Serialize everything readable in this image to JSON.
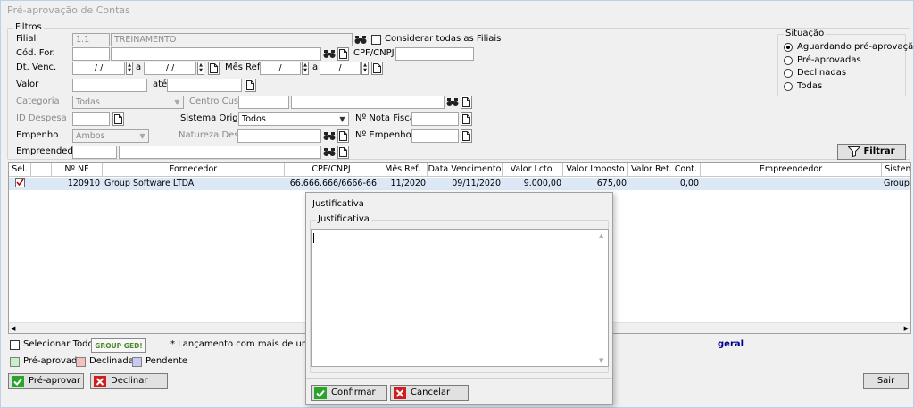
{
  "window": {
    "title": "Pré-aprovação de Contas"
  },
  "filters": {
    "group_label": "Filtros",
    "filial_label": "Filial",
    "filial_code": "1.1",
    "filial_name": "TREINAMENTO",
    "all_filiais_label": "Considerar todas as Filiais",
    "cod_for_label": "Cód. For.",
    "cpf_cnpj_label": "CPF/CNPJ",
    "dt_venc_label": "Dt. Venc.",
    "date_empty": " / /",
    "a_label": "a",
    "mes_ref_label": "Mês Ref.",
    "mes_empty": "/",
    "valor_label": "Valor",
    "ate_label": "até",
    "categoria_label": "Categoria",
    "categoria_value": "Todas",
    "centro_custo_label": "Centro Custo",
    "id_despesa_label": "ID Despesa",
    "sistema_origem_label": "Sistema Origem",
    "sistema_origem_value": "Todos",
    "nota_fiscal_label": "Nº Nota Fiscal",
    "empenho_label": "Empenho",
    "empenho_value": "Ambos",
    "natureza_label": "Natureza Desp.",
    "num_empenho_label": "Nº Empenho",
    "empreendedor_label": "Empreendedor",
    "filtrar_label": "Filtrar"
  },
  "situacao": {
    "group_label": "Situação",
    "options": [
      "Aguardando pré-aprovação",
      "Pré-aprovadas",
      "Declinadas",
      "Todas"
    ],
    "selected_index": 0
  },
  "grid": {
    "headers": [
      "Sel.",
      "",
      "Nº NF",
      "Fornecedor",
      "CPF/CNPJ",
      "Mês Ref.",
      "Data Vencimento",
      "Valor Lcto.",
      "Valor Imposto",
      "Valor Ret. Cont.",
      "Empreendedor",
      "Sistem"
    ],
    "rows": [
      {
        "num_nf": "120910",
        "fornecedor": "Group Software LTDA",
        "cpf_cnpj": "66.666.666/6666-66",
        "mes_ref": "11/2020",
        "data_venc": "09/11/2020",
        "valor_lcto": "9.000,00",
        "valor_imposto": "675,00",
        "valor_ret": "0,00",
        "sistema": "Group S"
      }
    ]
  },
  "bottom": {
    "select_all_label": "Selecionar Todos",
    "ged_logo": "GROUP GED!",
    "note": "* Lançamento com mais de uma Classi",
    "geral": "geral",
    "legend_preaprovada": "Pré-aprovada",
    "legend_declinada": "Declinada",
    "legend_pendente": "Pendente",
    "preaprovar_label": "Pré-aprovar",
    "declinar_label": "Declinar",
    "sair_label": "Sair",
    "colors": {
      "preaprovada": "#c8f0c8",
      "declinada": "#f5c0c0",
      "pendente": "#c8c8f5",
      "geral": "#00008b"
    }
  },
  "dialog": {
    "title": "Justificativa",
    "group_label": "Justificativa",
    "text_value": "",
    "confirm_label": "Confirmar",
    "cancel_label": "Cancelar"
  }
}
